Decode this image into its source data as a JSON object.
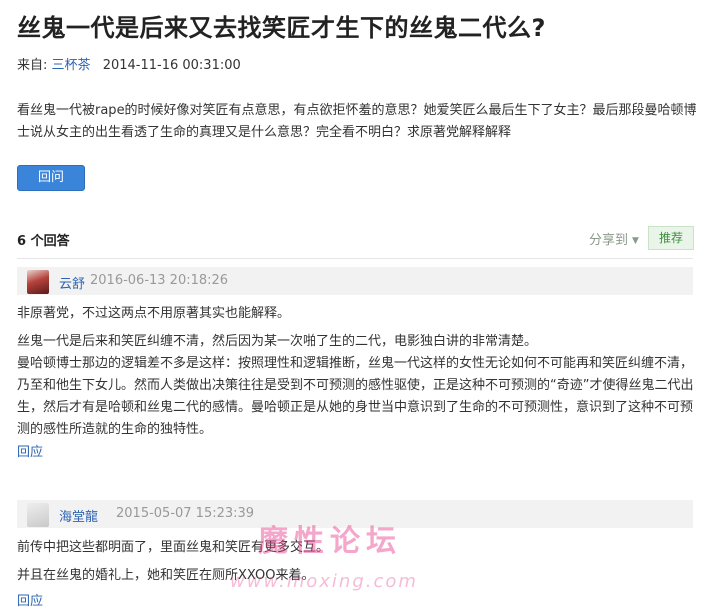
{
  "question": {
    "title": "丝鬼一代是后来又去找笑匠才生下的丝鬼二代么?",
    "from_label": "来自:",
    "author": "三杯茶",
    "date": "2014-11-16 00:31:00",
    "body": "看丝鬼一代被rape的时候好像对笑匠有点意思，有点欲拒怀羞的意思？她爱笑匠么最后生下了女主？最后那段曼哈顿博士说从女主的出生看透了生命的真理又是什么意思？完全看不明白？求原著党解释解释",
    "answer_button": "回问"
  },
  "answers_header": {
    "count_label": "6 个回答",
    "share_label": "分享到",
    "recommend_label": "推荐"
  },
  "answers": [
    {
      "author": "云舒",
      "date": "2016-06-13 20:18:26",
      "paragraphs": [
        "非原著党，不过这两点不用原著其实也能解释。",
        "丝鬼一代是后来和笑匠纠缠不清，然后因为某一次啪了生的二代，电影独白讲的非常清楚。",
        "曼哈顿博士那边的逻辑差不多是这样：按照理性和逻辑推断，丝鬼一代这样的女性无论如何不可能再和笑匠纠缠不清，乃至和他生下女儿。然而人类做出决策往往是受到不可预测的感性驱使，正是这种不可预测的“奇迹”才使得丝鬼二代出生，然后才有是哈顿和丝鬼二代的感情。曼哈顿正是从她的身世当中意识到了生命的不可预测性，意识到了这种不可预测的感性所造就的生命的独特性。"
      ],
      "reply_label": "回应"
    },
    {
      "author": "海堂龍",
      "date": "2015-05-07 15:23:39",
      "paragraphs": [
        "前传中把这些都明面了，里面丝鬼和笑匠有更多交互。",
        "并且在丝鬼的婚礼上，她和笑匠在厕所XXOO来着。"
      ],
      "reply_label": "回应"
    }
  ],
  "watermark": {
    "text": "魔性论坛",
    "url": "www.moxing.com"
  }
}
